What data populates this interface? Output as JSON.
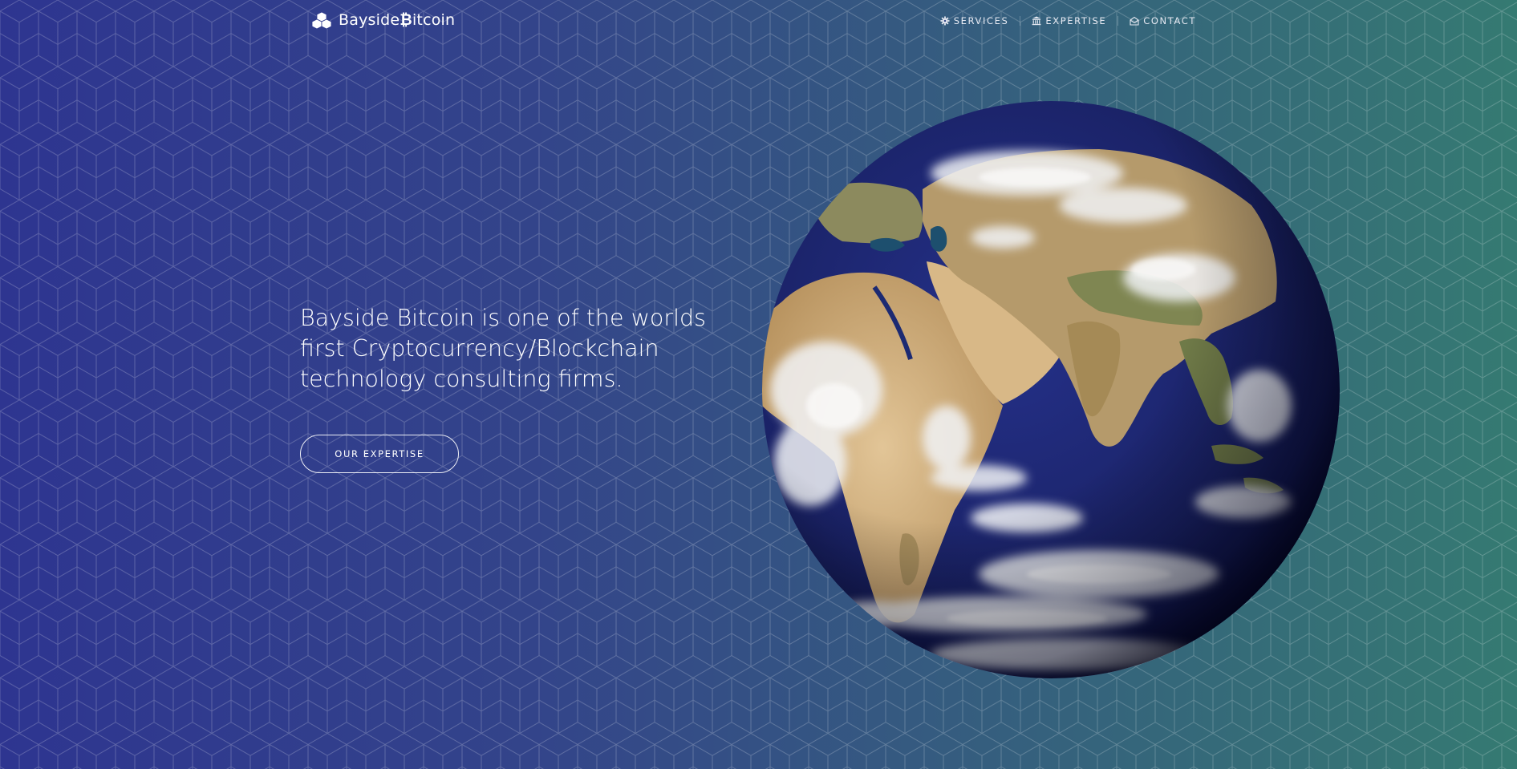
{
  "brand": {
    "name_prefix": "Bayside",
    "name_glyph": "₿",
    "name_suffix": "itcoin",
    "icon": "cubes-icon"
  },
  "nav": {
    "items": [
      {
        "label": "SERVICES",
        "icon": "gear-icon"
      },
      {
        "label": "EXPERTISE",
        "icon": "bank-icon"
      },
      {
        "label": "CONTACT",
        "icon": "envelope-open-icon"
      }
    ]
  },
  "hero": {
    "headline": "Bayside Bitcoin is one of the worlds first Cryptocurrency/Blockchain technology consulting firms.",
    "cta_label": "OUR EXPERTISE"
  },
  "colors": {
    "gradient_left": "#2e3590",
    "gradient_right": "#357a72",
    "ocean": "#1c2a72",
    "land": "#c9a878",
    "cloud": "#f2f4f6"
  }
}
